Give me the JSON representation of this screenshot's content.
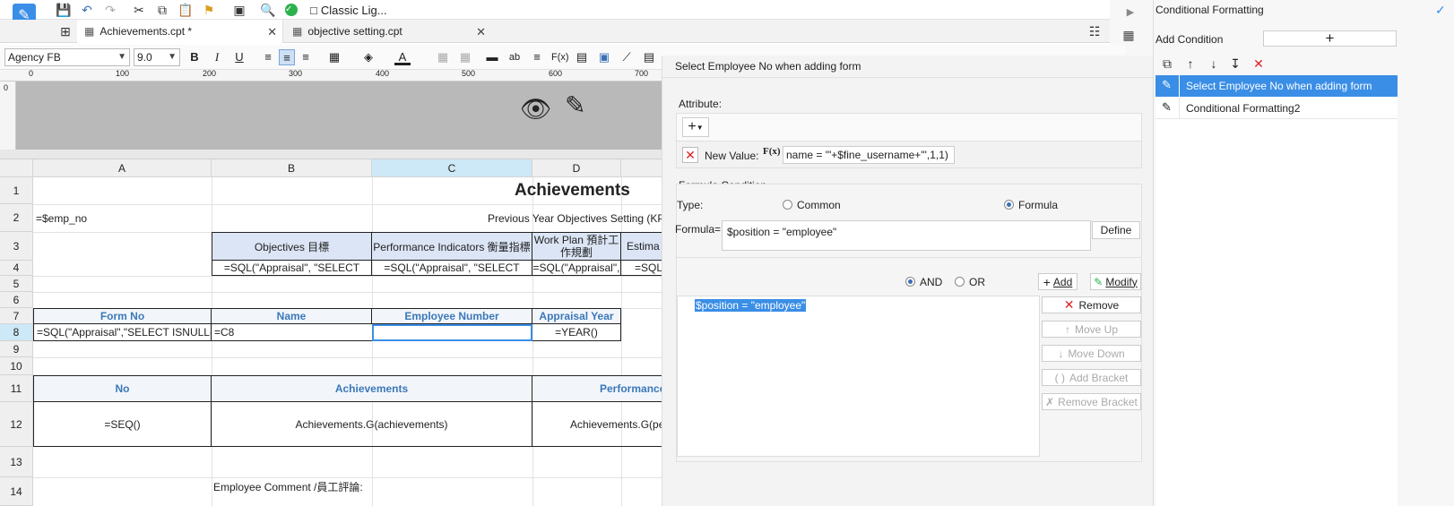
{
  "toolbar": {
    "classic_label": "Classic Lig..."
  },
  "tabs": [
    {
      "label": "Achievements.cpt *"
    },
    {
      "label": "objective setting.cpt"
    }
  ],
  "format": {
    "font_name": "Agency FB",
    "font_size": "9.0",
    "bold": "B",
    "italic": "I",
    "underline": "U"
  },
  "ruler": {
    "ticks": [
      "0",
      "100",
      "200",
      "300",
      "400",
      "500",
      "600",
      "700"
    ]
  },
  "grid": {
    "columns": [
      "A",
      "B",
      "C",
      "D"
    ],
    "rows": [
      "1",
      "2",
      "3",
      "4",
      "5",
      "6",
      "7",
      "8",
      "9",
      "10",
      "11",
      "12",
      "13",
      "14"
    ],
    "cells": {
      "c1_title": "Achievements",
      "a2": "=$emp_no",
      "c2": "Previous Year Objectives Setting (KP",
      "b3": "Objectives 目標",
      "c3": "Performance Indicators 衡量指標",
      "d3a": "Work Plan 預計工",
      "d3b": "作規劃",
      "e3": "Estima",
      "b4": "=SQL(\"Appraisal\", \"SELECT",
      "c4": "=SQL(\"Appraisal\", \"SELECT",
      "d4": "=SQL(\"Appraisal\",",
      "e4": "=SQL",
      "a7": "Form No",
      "b7": "Name",
      "c7": "Employee Number",
      "d7": "Appraisal Year",
      "a8": "=SQL(\"Appraisal\",\"SELECT ISNULL(",
      "b8": "=C8",
      "d8": "=YEAR()",
      "a11": "No",
      "b11": "Achievements",
      "d11": "Performance",
      "a12": "=SEQ()",
      "b12": "Achievements.G(achievements)",
      "d12": "Achievements.G(pe",
      "b14": "Employee Comment /員工評論:"
    }
  },
  "dialog": {
    "title": "Select Employee No when adding form",
    "attribute_label": "Attribute:",
    "new_value_label": "New Value:",
    "new_value_formula": "name = '\"+$fine_username+\"',1,1)",
    "formula_condition_label": "Formula Condition",
    "type_label": "Type:",
    "type_common": "Common",
    "type_formula": "Formula",
    "formula_label": "Formula=",
    "formula_value": "$position = \"employee\"",
    "define_button": "Define",
    "and_label": "AND",
    "or_label": "OR",
    "add_button": "Add",
    "modify_button": "Modify",
    "condition_item": "$position = \"employee\"",
    "remove_button": "Remove",
    "move_up_button": "Move Up",
    "move_down_button": "Move Down",
    "add_bracket_button": "Add Bracket",
    "remove_bracket_button": "Remove Bracket"
  },
  "cf_panel": {
    "title": "Conditional Formatting",
    "add_condition_label": "Add Condition",
    "add_symbol": "+",
    "items": [
      {
        "label": "Select Employee No when adding form",
        "selected": true
      },
      {
        "label": "Conditional Formatting2",
        "selected": false
      }
    ]
  },
  "colors": {
    "accent": "#3a8ee6",
    "selected_col": "#cde8f6",
    "header_fill": "#dbe5f5"
  }
}
